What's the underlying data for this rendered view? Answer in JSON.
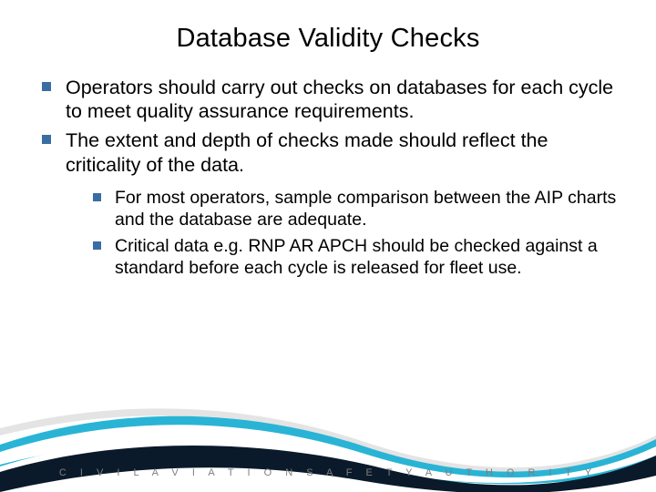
{
  "title": "Database Validity Checks",
  "bullets": {
    "b0": "Operators should carry out checks on databases for each cycle to meet quality assurance requirements.",
    "b1": "The extent and depth of checks made should reflect the criticality of the data."
  },
  "subbullets": {
    "s0": "For most operators, sample comparison between the AIP charts and the database are adequate.",
    "s1": "Critical data e.g. RNP AR APCH should be checked against a standard before each cycle is released for fleet use."
  },
  "footer": {
    "org": "C I V I L   A V I A T I O N   S A F E T Y   A U T H O R I T Y"
  },
  "colors": {
    "bullet": "#3a6da3",
    "swoosh_teal": "#29b4d5",
    "swoosh_dark": "#0a1a2a",
    "swoosh_white": "#ffffff",
    "swoosh_shadow": "#d0d0d0"
  }
}
